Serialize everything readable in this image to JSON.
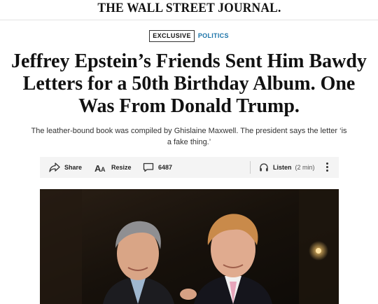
{
  "masthead": {
    "title": "THE WALL STREET JOURNAL."
  },
  "tags": {
    "exclusive": "EXCLUSIVE",
    "section": "POLITICS"
  },
  "headline": "Jeffrey Epstein’s Friends Sent Him Bawdy Letters for a 50th Birthday Album. One Was From Donald Trump.",
  "dek": "The leather-bound book was compiled by Ghislaine Maxwell. The president says the letter ‘is a fake thing.’",
  "toolbar": {
    "share_label": "Share",
    "resize_label": "Resize",
    "comments_count": "6487",
    "listen_label": "Listen",
    "listen_duration": "(2 min)",
    "icons": [
      "share-icon",
      "resize-icon",
      "comment-icon",
      "headphones-icon",
      "more-options-icon"
    ]
  },
  "colors": {
    "section_accent": "#1a73a8",
    "toolbar_bg": "#f4f4f4"
  }
}
